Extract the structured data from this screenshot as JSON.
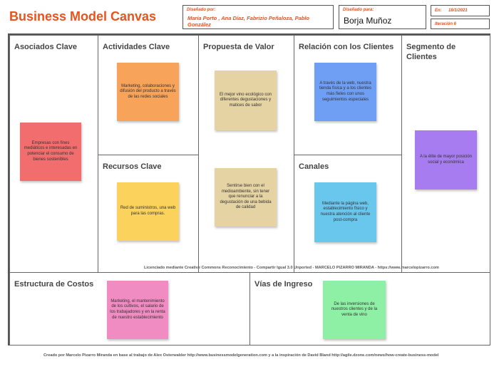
{
  "header": {
    "title": "Business Model Canvas",
    "designed_for_label": "Diseñado por:",
    "designed_for_value": "María Porto , Ana Díaz, Fabrizio Peñaloza, Pablo González",
    "designed_by_label": "Diseñado para:",
    "designed_by_value": "Borja Muñoz",
    "date_label": "En:",
    "date_value": "18/1/2021",
    "iteration_label": "Iteración 6"
  },
  "blocks": {
    "partners": {
      "title": "Asociados Clave",
      "note": "Empresas con fines mediáticos e interesadas en potenciar el consumo de bienes sostenibles",
      "color": "#f26d6d"
    },
    "activities": {
      "title": "Actividades Clave",
      "note": "Marketing, colaboraciones y difusión del producto a través de las redes sociales",
      "color": "#f8a35a"
    },
    "resources": {
      "title": "Recursos Clave",
      "note": "Red de suministros, una web para las compras.",
      "color": "#fbd35c"
    },
    "value": {
      "title": "Propuesta de Valor",
      "note1": "El mejor vino ecológico con diferentes degustaciones y matices de sabor",
      "note2": "Sentirse bien con el medioambiente, sin tener que renunciar a la degustación de una bebida de calidad",
      "color": "#e6d3a3"
    },
    "relations": {
      "title": "Relación con los Clientes",
      "note": "A través de la web, nuestra tienda física y a los clientes más fieles con unos seguimientos especiales",
      "color": "#6f9ff5"
    },
    "channels": {
      "title": "Canales",
      "note": "Mediante la página web, establecimiento físico y nuestra atención al cliente post-compra",
      "color": "#69c6ec"
    },
    "segments": {
      "title": "Segmento de Clientes",
      "note": "A la élite de mayor posición social y económica",
      "color": "#a77cf0"
    },
    "costs": {
      "title": "Estructura de Costos",
      "note": "Marketing, el mantenimiento de los cultivos, el salario de los trabajadores y en la renta de nuestro establecimiento",
      "color": "#f08cc1"
    },
    "revenue": {
      "title": "Vías de Ingreso",
      "note": "De las inversiones de nuestros clientes y de la venta de vino",
      "color": "#8ef0a5"
    }
  },
  "license": "Licenciado mediante Creative Commons Reconocimiento - Compartir Igual 3.0 Unported - MARCELO PIZARRO MIRANDA - https://www.marcelopizarro.com",
  "footer": "Creado por Marcelo Pizarro Miranda en base al trabajo de Alex Osterwalder http://www.businessmodelgeneration.com y a la inspiración de David Bland http://agile.dzone.com/news/how-create-business-model"
}
